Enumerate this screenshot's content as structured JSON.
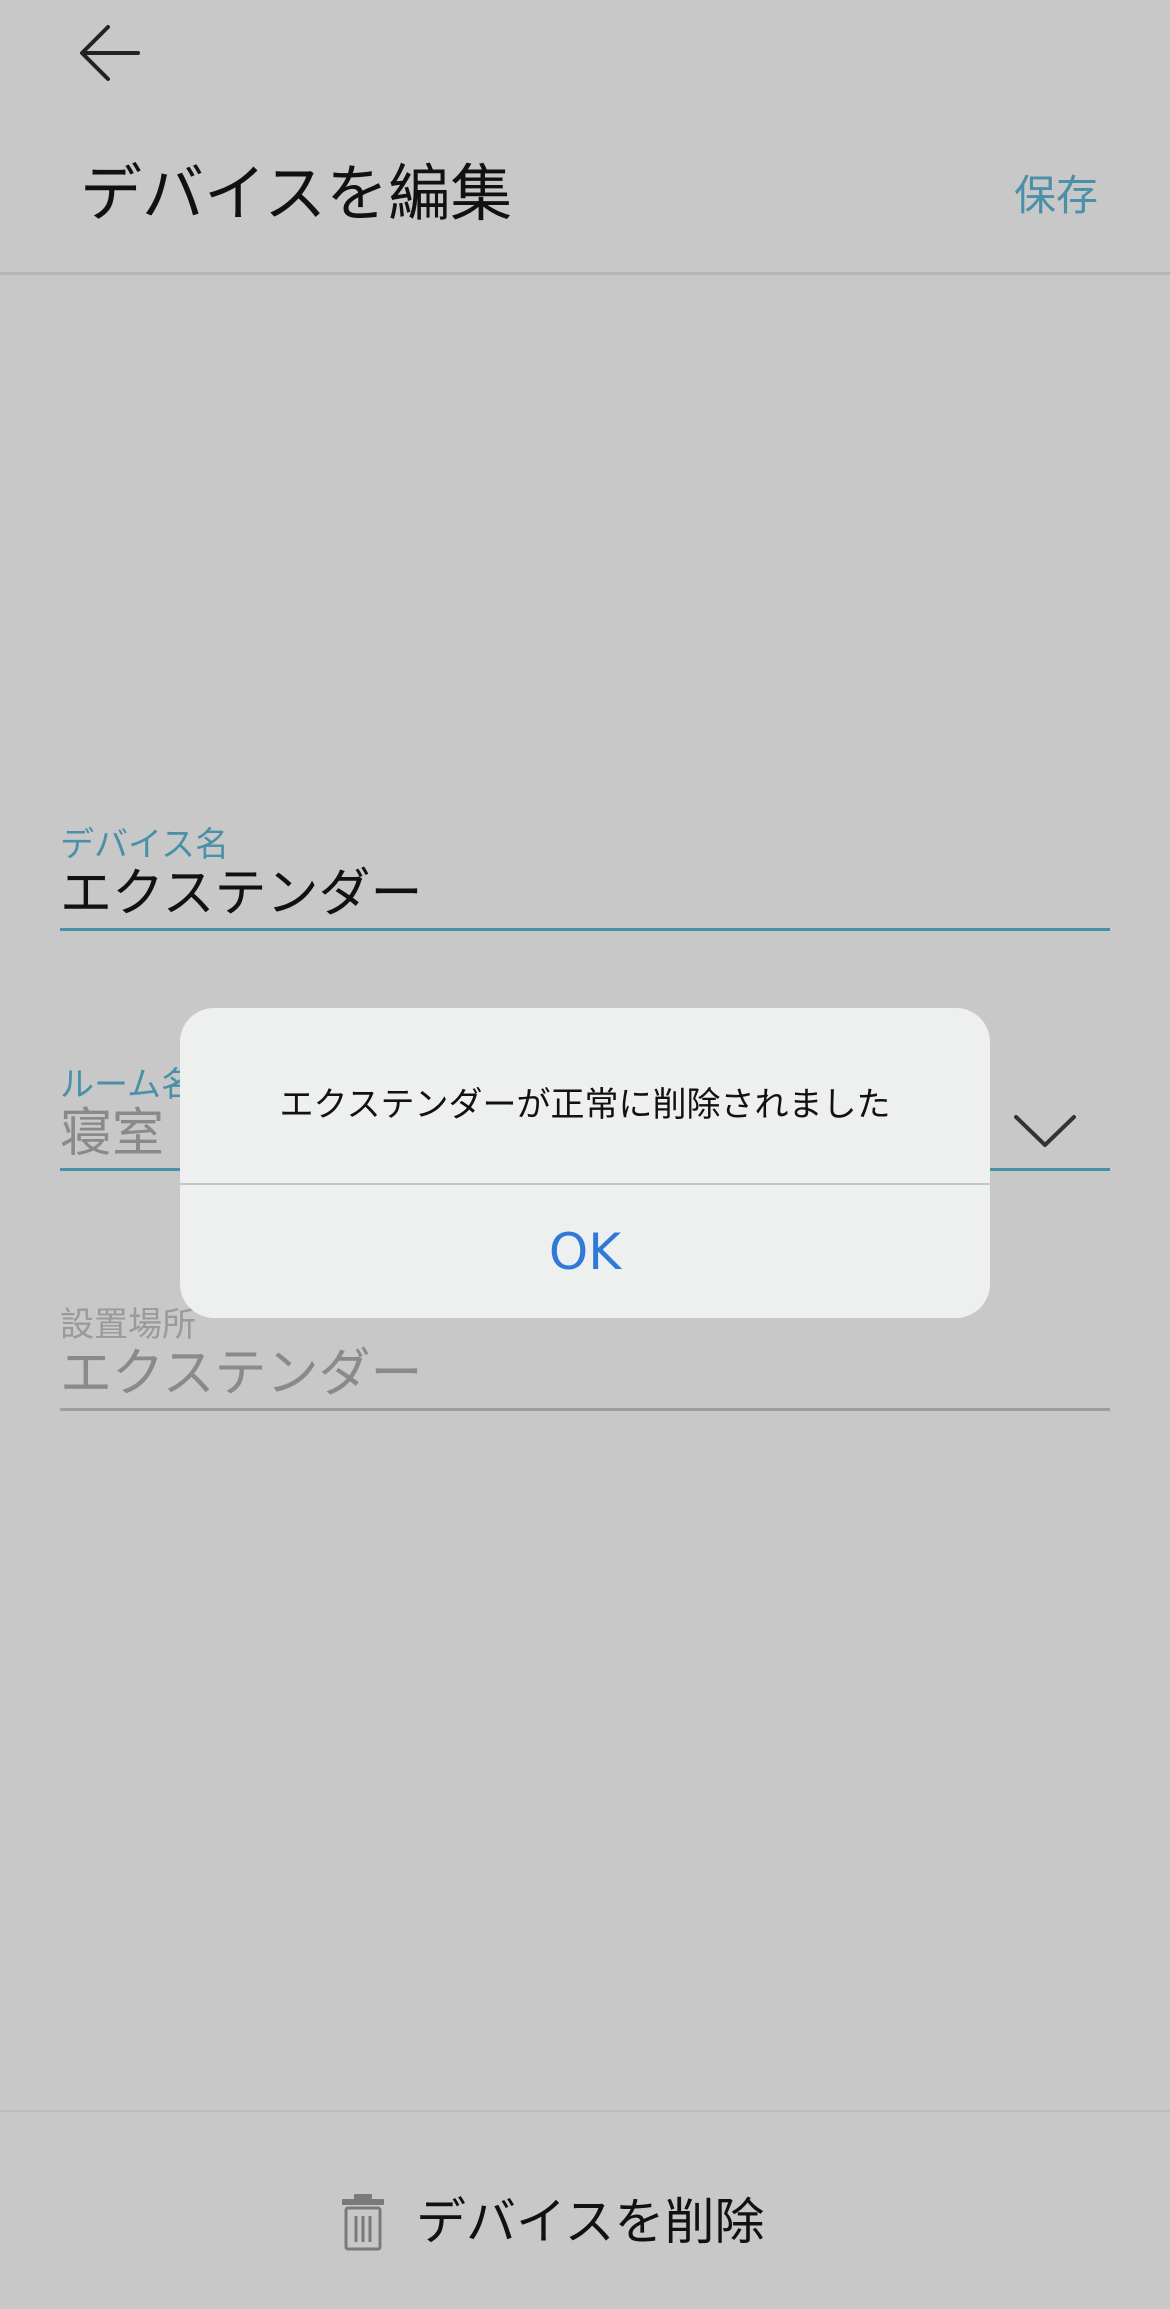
{
  "header": {
    "back_icon": "arrow-left-icon",
    "title": "デバイスを編集",
    "save_label": "保存"
  },
  "form": {
    "device_name": {
      "label": "デバイス名",
      "value": "エクステンダー"
    },
    "room_name": {
      "label": "ルーム名",
      "value": "寝室",
      "dropdown_icon": "chevron-down-icon"
    },
    "location": {
      "label": "設置場所",
      "value": "エクステンダー"
    }
  },
  "footer": {
    "delete_icon": "trash-icon",
    "delete_label": "デバイスを削除"
  },
  "dialog": {
    "message": "エクステンダーが正常に削除されました",
    "ok_label": "OK"
  },
  "colors": {
    "accent": "#4a90a8",
    "dialog_button": "#2f7ad9",
    "background": "#c8c8c8",
    "dialog_background": "#eef0f0"
  }
}
